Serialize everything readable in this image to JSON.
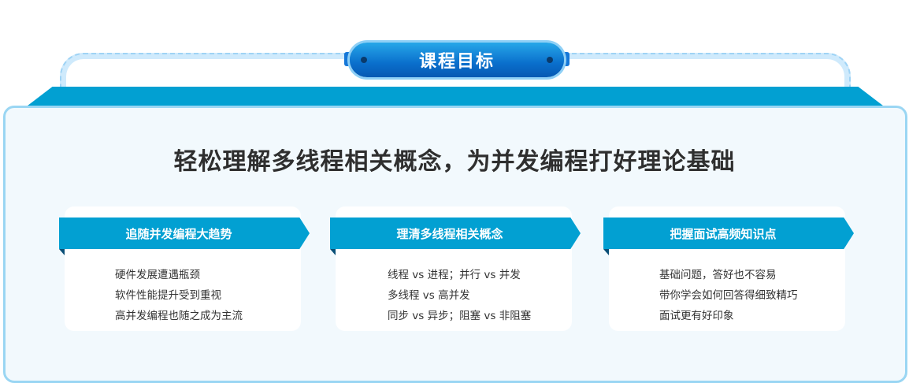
{
  "title": "课程目标",
  "headline": "轻松理解多线程相关概念，为并发编程打好理论基础",
  "cards": [
    {
      "heading": "追随并发编程大趋势",
      "items": [
        "硬件发展遭遇瓶颈",
        "软件性能提升受到重视",
        "高并发编程也随之成为主流"
      ]
    },
    {
      "heading": "理清多线程相关概念",
      "items": [
        "线程 vs 进程；并行 vs 并发",
        "多线程 vs 高并发",
        "同步 vs 异步；阻塞 vs 非阻塞"
      ]
    },
    {
      "heading": "把握面试高频知识点",
      "items": [
        "基础问题，答好也不容易",
        "带你学会如何回答得细致精巧",
        "面试更有好印象"
      ]
    }
  ],
  "colors": {
    "accent": "#02a0d2",
    "panel_border": "#9ad6f3",
    "pill": "#0a6fcc"
  }
}
